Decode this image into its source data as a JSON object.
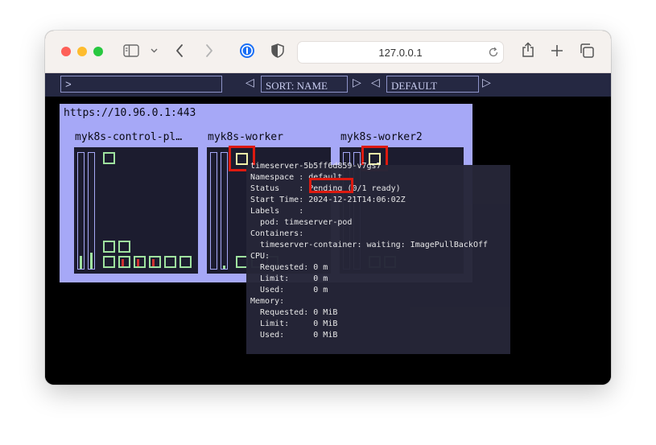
{
  "browser": {
    "url": "127.0.0.1",
    "traffic_lights": {
      "close": "#fe5f57",
      "minimize": "#febc2e",
      "maximize": "#28c840"
    },
    "icons": [
      "sidebar-icon",
      "chevron-down-icon",
      "back-icon",
      "forward-icon",
      "onepassword-icon",
      "shield-icon",
      "reload-icon",
      "share-icon",
      "plus-icon",
      "tabs-icon"
    ]
  },
  "toolbar": {
    "filter_value": ">",
    "sort_label": "SORT: NAME",
    "namespace_label": "DEFAULT"
  },
  "cluster": {
    "endpoint": "https://10.96.0.1:443",
    "nodes": [
      {
        "name": "myk8s-control-pl…"
      },
      {
        "name": "myk8s-worker"
      },
      {
        "name": "myk8s-worker2"
      }
    ]
  },
  "popup": {
    "pod_name": "timeserver-5b5ff6d859-v7gs7",
    "namespace_line": "Namespace : default",
    "status_prefix": "Status    : ",
    "status_value": "Pending",
    "status_suffix": " (0/1 ready)",
    "start_time_line": "Start Time: 2024-12-21T14:06:02Z",
    "labels_line": "Labels    :",
    "label_pod_line": "  pod: timeserver-pod",
    "containers_line": "Containers:",
    "container_line": "  timeserver-container: waiting: ImagePullBackOff",
    "cpu_line": "CPU:",
    "cpu_requested": "  Requested: 0 m",
    "cpu_limit": "  Limit:     0 m",
    "cpu_used": "  Used:      0 m",
    "memory_line": "Memory:",
    "mem_requested": "  Requested: 0 MiB",
    "mem_limit": "  Limit:     0 MiB",
    "mem_used": "  Used:      0 MiB"
  },
  "colors": {
    "panel": "#a6a8f7",
    "node_bg": "#1c1c2f",
    "pod_ok": "#9fe29f",
    "pod_pending": "#f0f0a8",
    "highlight": "#dd1a10",
    "toolbar_bg": "#252842"
  }
}
